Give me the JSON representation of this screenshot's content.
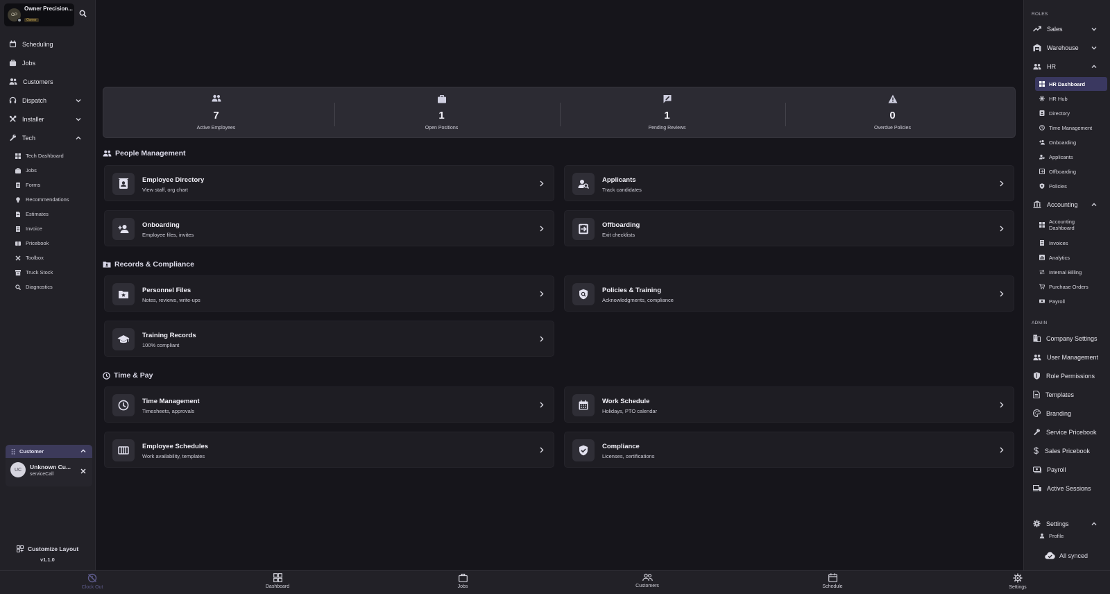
{
  "account": {
    "initials": "OP",
    "name": "Owner Precision...",
    "role": "Owner"
  },
  "left_nav": {
    "main": [
      {
        "label": "Scheduling",
        "icon": "calendar-icon"
      },
      {
        "label": "Jobs",
        "icon": "briefcase-icon"
      },
      {
        "label": "Customers",
        "icon": "people-icon"
      },
      {
        "label": "Dispatch",
        "icon": "headset-icon"
      },
      {
        "label": "Installer",
        "icon": "tools-icon"
      },
      {
        "label": "Tech",
        "icon": "wrench-icon"
      }
    ],
    "tech_items": [
      "Tech Dashboard",
      "Jobs",
      "Forms",
      "Recommendations",
      "Estimates",
      "Invoice",
      "Pricebook",
      "Toolbox",
      "Truck Stock",
      "Diagnostics"
    ]
  },
  "customer_panel": {
    "title": "Customer",
    "initials": "UC",
    "name": "Unknown Cu...",
    "type": "serviceCall"
  },
  "customize_layout": "Customize Layout",
  "version": "v1.1.0",
  "stats": [
    {
      "value": "7",
      "label": "Active Employees",
      "icon": "people-icon"
    },
    {
      "value": "1",
      "label": "Open Positions",
      "icon": "briefcase-icon"
    },
    {
      "value": "1",
      "label": "Pending Reviews",
      "icon": "review-icon"
    },
    {
      "value": "0",
      "label": "Overdue Policies",
      "icon": "warning-icon"
    }
  ],
  "sections": {
    "people": "People Management",
    "records": "Records & Compliance",
    "timepay": "Time & Pay"
  },
  "cards": {
    "directory": {
      "title": "Employee Directory",
      "sub": "View staff, org chart"
    },
    "applicants": {
      "title": "Applicants",
      "sub": "Track candidates"
    },
    "onboarding": {
      "title": "Onboarding",
      "sub": "Employee files, invites"
    },
    "offboarding": {
      "title": "Offboarding",
      "sub": "Exit checklists"
    },
    "personnel": {
      "title": "Personnel Files",
      "sub": "Notes, reviews, write-ups"
    },
    "policies": {
      "title": "Policies & Training",
      "sub": "Acknowledgments, compliance"
    },
    "training": {
      "title": "Training Records",
      "sub": "100% compliant"
    },
    "time": {
      "title": "Time Management",
      "sub": "Timesheets, approvals"
    },
    "work": {
      "title": "Work Schedule",
      "sub": "Holidays, PTO calendar"
    },
    "schedules": {
      "title": "Employee Schedules",
      "sub": "Work availability, templates"
    },
    "compliance": {
      "title": "Compliance",
      "sub": "Licenses, certifications"
    }
  },
  "right_nav": {
    "roles_header": "ROLES",
    "roles": [
      {
        "label": "Sales"
      },
      {
        "label": "Warehouse"
      },
      {
        "label": "HR"
      }
    ],
    "hr_items": [
      "HR Dashboard",
      "HR Hub",
      "Directory",
      "Time Management",
      "Onboarding",
      "Applicants",
      "Offboarding",
      "Policies"
    ],
    "accounting": "Accounting",
    "accounting_items": [
      "Accounting Dashboard",
      "Invoices",
      "Analytics",
      "Internal Billing",
      "Purchase Orders",
      "Payroll"
    ],
    "admin_header": "ADMIN",
    "admin": [
      "Company Settings",
      "User Management",
      "Role Permissions",
      "Templates",
      "Branding",
      "Service Pricebook",
      "Sales Pricebook",
      "Payroll",
      "Active Sessions"
    ],
    "settings": "Settings",
    "settings_items": [
      "Profile"
    ],
    "sync_status": "All synced"
  },
  "bottom_bar": [
    "Clock Out",
    "Dashboard",
    "Jobs",
    "Customers",
    "Schedule",
    "Settings"
  ],
  "colors": {
    "accent": "#3a3860",
    "clock_out": "#5e5c8c"
  }
}
